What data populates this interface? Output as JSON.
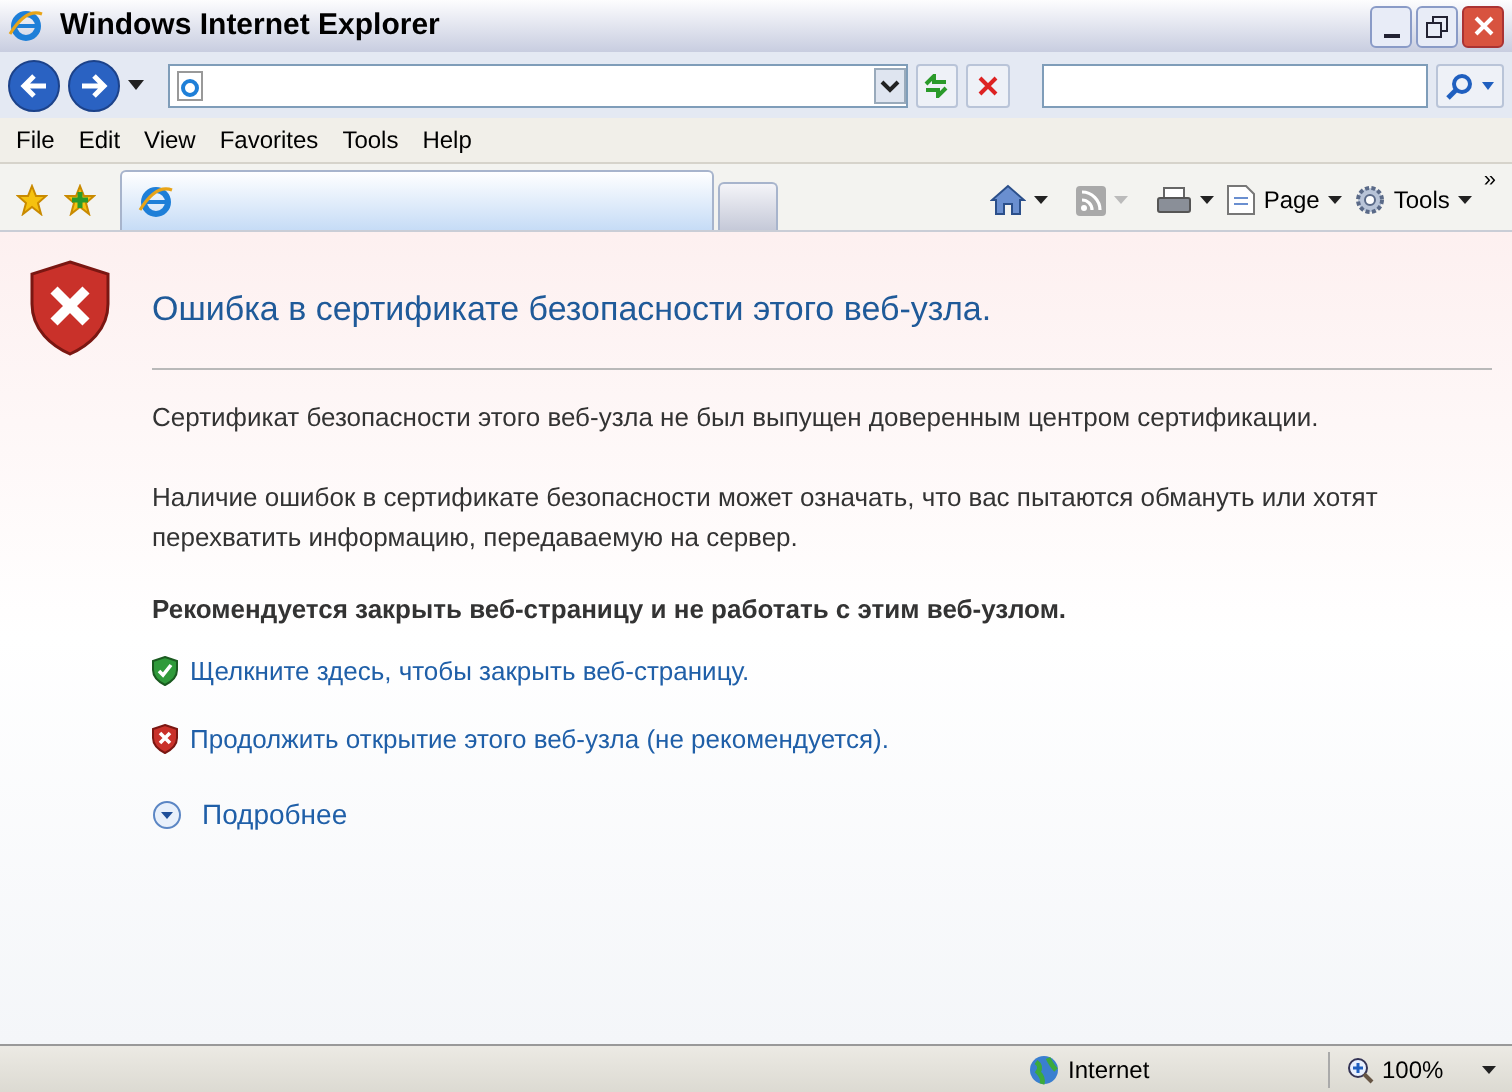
{
  "window": {
    "title": "Windows Internet Explorer"
  },
  "menu": [
    "File",
    "Edit",
    "View",
    "Favorites",
    "Tools",
    "Help"
  ],
  "tabs": [
    {
      "selected": true
    },
    {
      "selected": false
    }
  ],
  "command_bar": {
    "page": "Page",
    "tools": "Tools",
    "more": "»"
  },
  "content": {
    "heading": "Ошибка в сертификате безопасности этого веб-узла.",
    "paragraphs": [
      "Сертификат безопасности этого веб-узла не был выпущен доверенным центром сертификации.",
      "Наличие ошибок в сертификате безопасности может означать, что вас пытаются обмануть или хотят перехватить информацию, передаваемую на сервер."
    ],
    "recommendation": "Рекомендуется закрыть веб-страницу и не работать с этим веб-узлом.",
    "links": [
      {
        "kind": "safe",
        "text": "Щелкните здесь, чтобы закрыть веб-страницу."
      },
      {
        "kind": "unsafe",
        "text": "Продолжить открытие этого веб-узла (не рекомендуется)."
      }
    ],
    "more_info": {
      "text": "Подробнее",
      "expanded": false
    }
  },
  "status_bar": {
    "zone": "Internet",
    "zoom": "100%"
  }
}
